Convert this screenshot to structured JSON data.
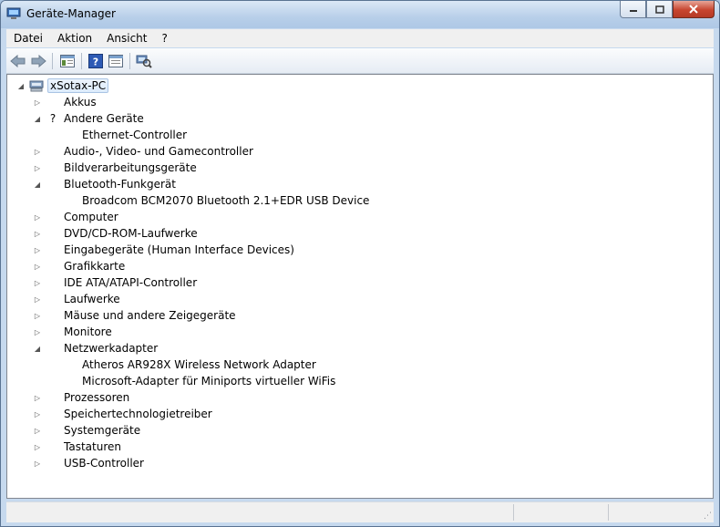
{
  "window": {
    "title": "Geräte-Manager"
  },
  "menu": [
    "Datei",
    "Aktion",
    "Ansicht",
    "?"
  ],
  "toolbar": [
    "back-arrow-icon",
    "forward-arrow-icon",
    "show-hide-tree-icon",
    "help-icon",
    "properties-icon",
    "scan-hardware-icon"
  ],
  "tree": {
    "root": "xSotax-PC",
    "items": [
      {
        "label": "Akkus",
        "icon": "battery-icon",
        "expanded": false,
        "children": []
      },
      {
        "label": "Andere Geräte",
        "icon": "unknown-device-icon",
        "expanded": true,
        "children": [
          {
            "label": "Ethernet-Controller",
            "icon": "warning-device-icon"
          }
        ]
      },
      {
        "label": "Audio-, Video- und Gamecontroller",
        "icon": "audio-icon",
        "expanded": false,
        "children": []
      },
      {
        "label": "Bildverarbeitungsgeräte",
        "icon": "camera-icon",
        "expanded": false,
        "children": []
      },
      {
        "label": "Bluetooth-Funkgerät",
        "icon": "bluetooth-icon",
        "expanded": true,
        "children": [
          {
            "label": "Broadcom BCM2070 Bluetooth 2.1+EDR USB Device",
            "icon": "bluetooth-icon"
          }
        ]
      },
      {
        "label": "Computer",
        "icon": "computer-icon",
        "expanded": false,
        "children": []
      },
      {
        "label": "DVD/CD-ROM-Laufwerke",
        "icon": "dvd-drive-icon",
        "expanded": false,
        "children": []
      },
      {
        "label": "Eingabegeräte (Human Interface Devices)",
        "icon": "hid-icon",
        "expanded": false,
        "children": []
      },
      {
        "label": "Grafikkarte",
        "icon": "display-adapter-icon",
        "expanded": false,
        "children": []
      },
      {
        "label": "IDE ATA/ATAPI-Controller",
        "icon": "ide-controller-icon",
        "expanded": false,
        "children": []
      },
      {
        "label": "Laufwerke",
        "icon": "disk-drive-icon",
        "expanded": false,
        "children": []
      },
      {
        "label": "Mäuse und andere Zeigegeräte",
        "icon": "mouse-icon",
        "expanded": false,
        "children": []
      },
      {
        "label": "Monitore",
        "icon": "monitor-icon",
        "expanded": false,
        "children": []
      },
      {
        "label": "Netzwerkadapter",
        "icon": "network-adapter-icon",
        "expanded": true,
        "children": [
          {
            "label": "Atheros AR928X Wireless Network Adapter",
            "icon": "network-adapter-icon"
          },
          {
            "label": "Microsoft-Adapter für Miniports virtueller WiFis",
            "icon": "network-adapter-icon"
          }
        ]
      },
      {
        "label": "Prozessoren",
        "icon": "processor-icon",
        "expanded": false,
        "children": []
      },
      {
        "label": "Speichertechnologietreiber",
        "icon": "storage-driver-icon",
        "expanded": false,
        "children": []
      },
      {
        "label": "Systemgeräte",
        "icon": "system-devices-icon",
        "expanded": false,
        "children": []
      },
      {
        "label": "Tastaturen",
        "icon": "keyboard-icon",
        "expanded": false,
        "children": []
      },
      {
        "label": "USB-Controller",
        "icon": "usb-icon",
        "expanded": false,
        "children": []
      }
    ]
  },
  "colors": {
    "titlebar": "#b8cfe9",
    "close": "#c7452f",
    "selection": "#dcebfc"
  }
}
